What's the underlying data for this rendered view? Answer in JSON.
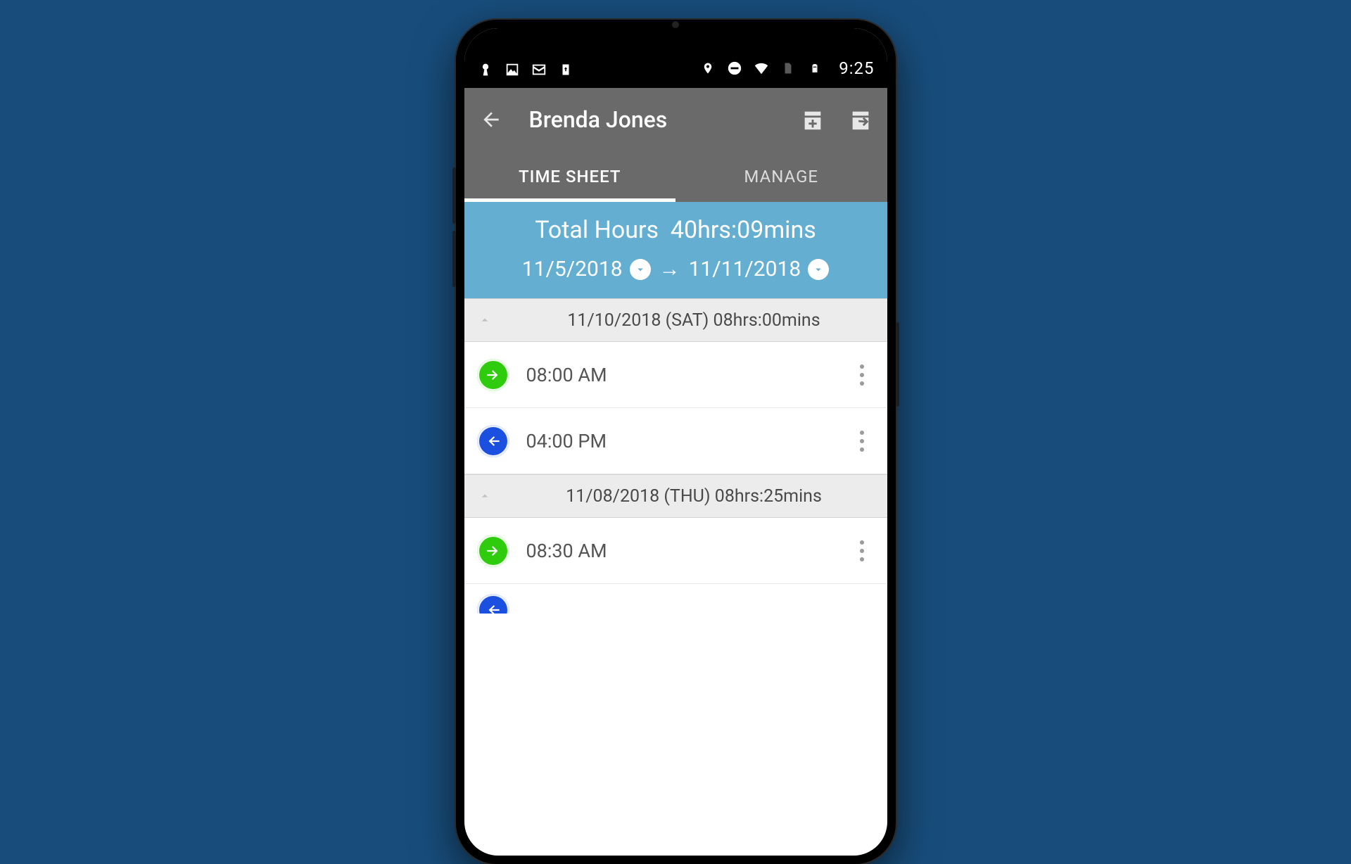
{
  "statusbar": {
    "time": "9:25"
  },
  "appbar": {
    "title": "Brenda Jones"
  },
  "tabs": {
    "items": [
      {
        "label": "TIME SHEET",
        "active": true
      },
      {
        "label": "MANAGE",
        "active": false
      }
    ]
  },
  "summary": {
    "total_label": "Total Hours",
    "total_value": "40hrs:09mins",
    "date_start": "11/5/2018",
    "date_end": "11/11/2018"
  },
  "days": [
    {
      "header": "11/10/2018 (SAT)  08hrs:00mins",
      "entries": [
        {
          "type": "in",
          "time": "08:00 AM"
        },
        {
          "type": "out",
          "time": "04:00 PM"
        }
      ]
    },
    {
      "header": "11/08/2018 (THU)  08hrs:25mins",
      "entries": [
        {
          "type": "in",
          "time": "08:30 AM"
        }
      ]
    }
  ]
}
